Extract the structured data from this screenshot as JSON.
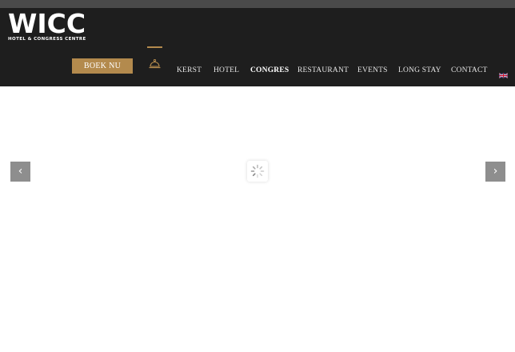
{
  "logo": {
    "name": "WICC",
    "tagline": "HOTEL & CONGRESS CENTRE"
  },
  "header": {
    "book_label": "BOEK NU",
    "nav": [
      {
        "label": "KERST"
      },
      {
        "label": "HOTEL"
      },
      {
        "label": "CONGRES"
      },
      {
        "label": "RESTAURANT"
      },
      {
        "label": "EVENTS"
      },
      {
        "label": "LONG STAY"
      },
      {
        "label": "CONTACT"
      }
    ],
    "language_icon": "uk-flag-icon",
    "home_icon": "hotel-bell-icon"
  },
  "slider": {
    "prev_icon": "chevron-left-icon",
    "next_icon": "chevron-right-icon",
    "prev_glyph": "‹",
    "next_glyph": "›",
    "loading_icon": "spinner-icon"
  },
  "colors": {
    "header_bg": "#1e1e1e",
    "top_strip": "#4a4a4a",
    "accent_gold": "#b38a4d",
    "arrow_bg": "#8e8e8e"
  }
}
